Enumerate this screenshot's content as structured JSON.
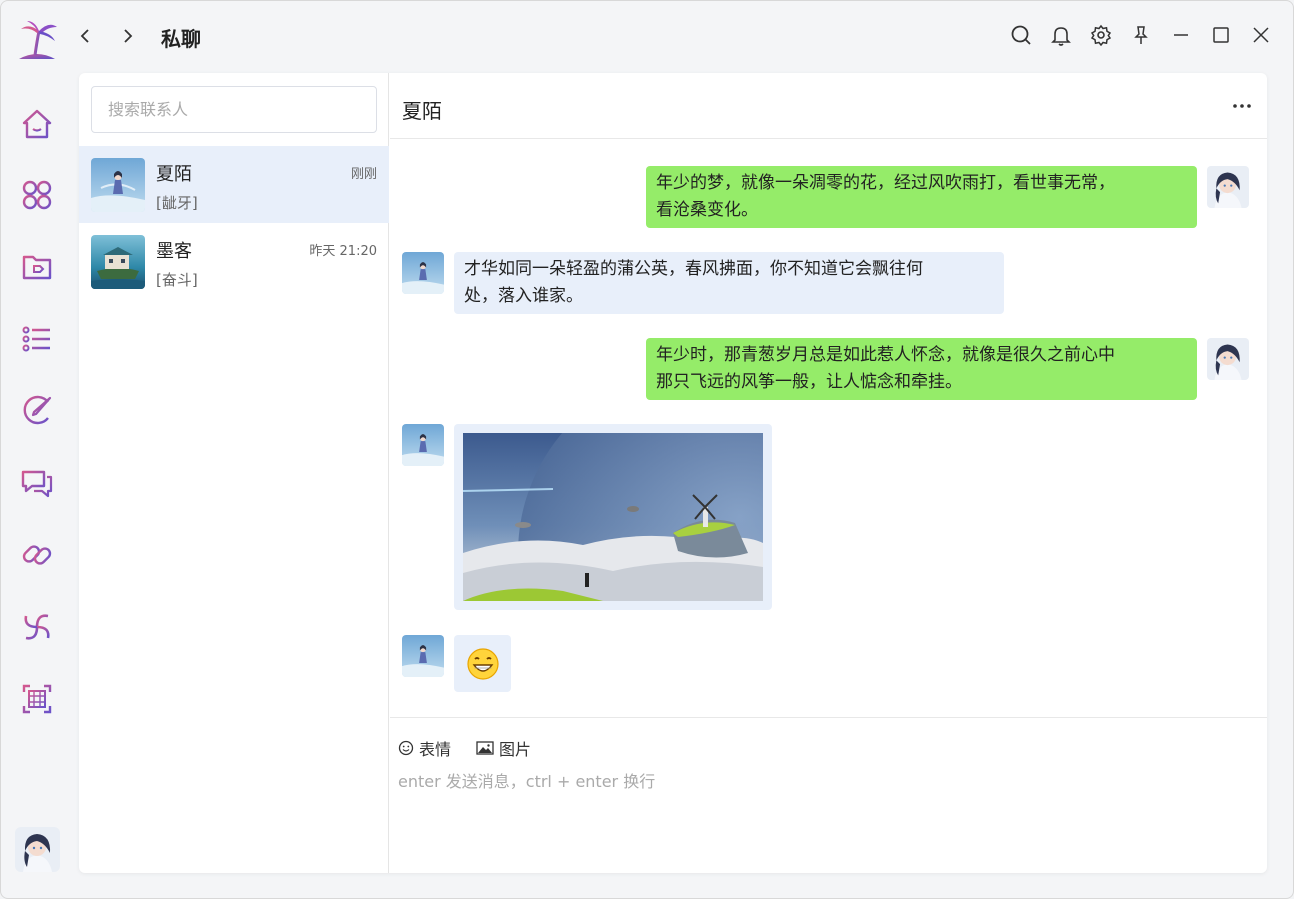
{
  "app": {
    "title": "私聊"
  },
  "colors": {
    "accent": "#8a5cc7",
    "bubble_me": "#95ec69",
    "bubble_them": "#e8effa",
    "active_contact": "#e8effa"
  },
  "window_icons": [
    "search-icon",
    "bell-icon",
    "gear-icon",
    "pin-icon",
    "minimize-icon",
    "maximize-icon",
    "close-icon"
  ],
  "rail": {
    "items": [
      "home-icon",
      "apps-icon",
      "folder-tag-icon",
      "list-icon",
      "paint-icon",
      "chat-bubbles-icon",
      "link-icon",
      "vortex-icon",
      "grid-icon"
    ]
  },
  "contacts": {
    "search_placeholder": "搜索联系人",
    "items": [
      {
        "name": "夏陌",
        "time": "刚刚",
        "last_msg": "[龇牙]",
        "active": true
      },
      {
        "name": "墨客",
        "time": "昨天 21:20",
        "last_msg": "[奋斗]",
        "active": false
      }
    ]
  },
  "chat": {
    "title": "夏陌",
    "messages": [
      {
        "from": "me",
        "lines": [
          "年少的梦，就像一朵凋零的花，经过风吹雨打，看世事无常，",
          "看沧桑变化。"
        ]
      },
      {
        "from": "them",
        "lines": [
          "才华如同一朵轻盈的蒲公英，春风拂面，你不知道它会飘往何",
          "处，落入谁家。"
        ]
      },
      {
        "from": "me",
        "lines": [
          "年少时，那青葱岁月总是如此惹人怀念，就像是很久之前心中",
          "那只飞远的风筝一般，让人惦念和牵挂。"
        ]
      },
      {
        "from": "them",
        "type": "image"
      },
      {
        "from": "them",
        "type": "emoji",
        "emoji": "😁"
      }
    ]
  },
  "composer": {
    "emoji_label": "表情",
    "image_label": "图片",
    "placeholder": "enter 发送消息，ctrl + enter 换行"
  }
}
